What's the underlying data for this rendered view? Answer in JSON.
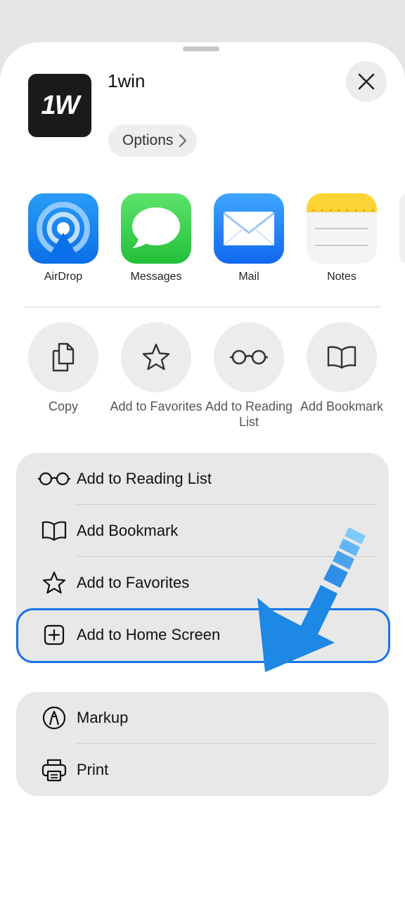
{
  "header": {
    "app_logo_text": "1W",
    "app_title": "1win",
    "options_label": "Options"
  },
  "share_apps": [
    {
      "label": "AirDrop",
      "icon": "airdrop-icon"
    },
    {
      "label": "Messages",
      "icon": "messages-icon"
    },
    {
      "label": "Mail",
      "icon": "mail-icon"
    },
    {
      "label": "Notes",
      "icon": "notes-icon"
    }
  ],
  "quick_actions": [
    {
      "label": "Copy",
      "icon": "copy-icon"
    },
    {
      "label": "Add to Favorites",
      "icon": "star-icon"
    },
    {
      "label": "Add to Reading List",
      "icon": "glasses-icon"
    },
    {
      "label": "Add Bookmark",
      "icon": "book-icon"
    }
  ],
  "action_list": [
    {
      "label": "Add to Reading List",
      "icon": "glasses-icon"
    },
    {
      "label": "Add Bookmark",
      "icon": "book-icon"
    },
    {
      "label": "Add to Favorites",
      "icon": "star-icon"
    },
    {
      "label": "Add to Home Screen",
      "icon": "plus-square-icon",
      "highlighted": true
    }
  ],
  "secondary_list": [
    {
      "label": "Markup",
      "icon": "markup-icon"
    },
    {
      "label": "Print",
      "icon": "printer-icon"
    }
  ],
  "colors": {
    "highlight": "#1a73e8",
    "arrow": "#1e88e5"
  }
}
